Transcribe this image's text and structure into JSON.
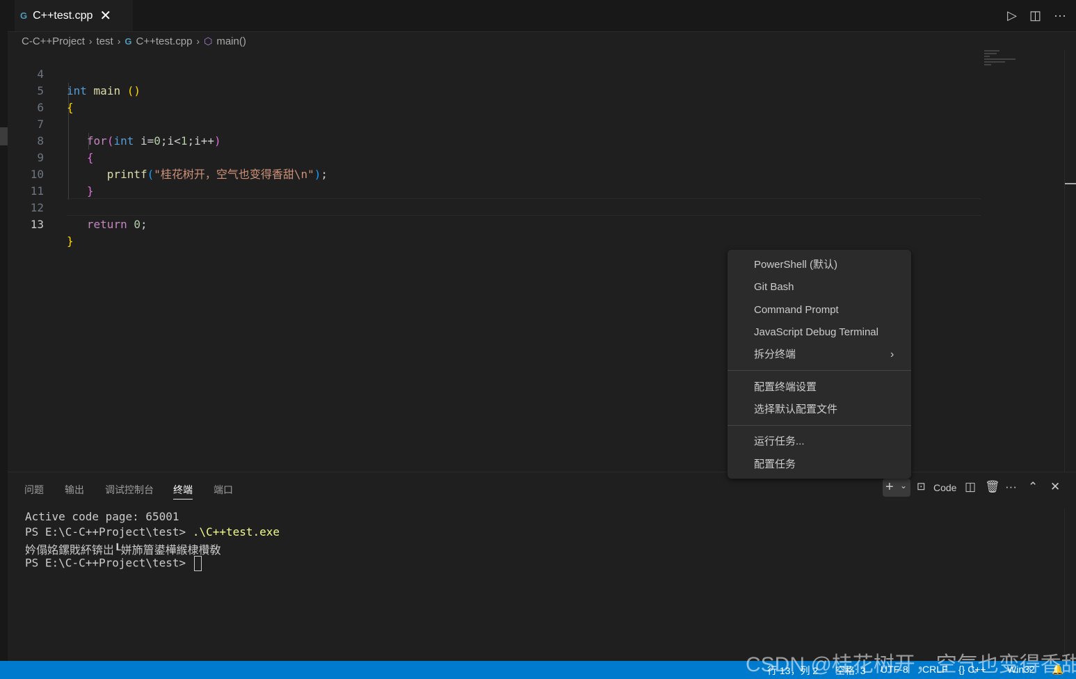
{
  "tab": {
    "title": "C++test.cpp",
    "lang_icon": "G",
    "close": "✕"
  },
  "title_actions": {
    "run": "▷",
    "split": "◫",
    "more": "···"
  },
  "breadcrumb": {
    "items": [
      "C-C++Project",
      "test",
      "C++test.cpp",
      "main()"
    ],
    "separator": "›"
  },
  "editor": {
    "line_numbers": [
      "4",
      "5",
      "6",
      "7",
      "8",
      "9",
      "10",
      "11",
      "12",
      "13"
    ]
  },
  "context_menu": {
    "items": [
      "PowerShell (默认)",
      "Git Bash",
      "Command Prompt",
      "JavaScript Debug Terminal",
      "拆分终端",
      "配置终端设置",
      "选择默认配置文件",
      "运行任务...",
      "配置任务"
    ],
    "submenu_arrow": "›"
  },
  "panel": {
    "tabs": [
      "问题",
      "输出",
      "调试控制台",
      "终端",
      "端口"
    ],
    "active_tab": "终端",
    "terminal_name": "Code",
    "terminal": {
      "line1": "Active code page: 65001",
      "prompt": "PS E:\\C-C++Project\\test> ",
      "command": ".\\C++test.exe",
      "output": "妗傝姳鏍戝紑锛岀┖姘斾篃鍙樺緱棣欑敎",
      "prompt2": "PS E:\\C-C++Project\\test> "
    }
  },
  "statusbar": {
    "position": "行 13，列 2",
    "spaces": "空格: 3",
    "encoding": "UTF-8",
    "eol": "CRLF",
    "language": "{} C++",
    "platform": "Win32"
  },
  "watermark": "CSDN @桂花树开，空气也变得香甜",
  "colors": {
    "statusbar": "#007acc",
    "editor_bg": "#1f1f1f",
    "keyword": "#569cd6",
    "string": "#ce9178"
  }
}
